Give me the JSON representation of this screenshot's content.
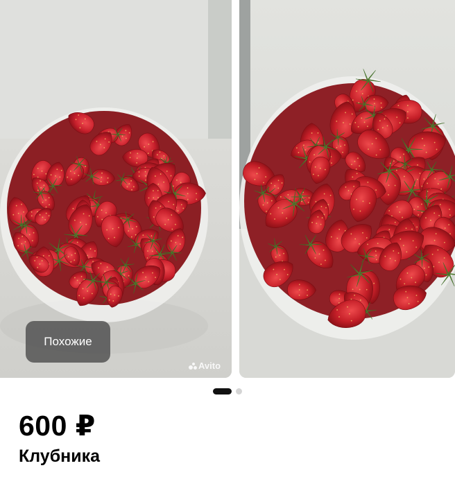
{
  "gallery": {
    "photos": [
      {
        "subject": "bowl of strawberries"
      },
      {
        "subject": "bowl of strawberries"
      }
    ],
    "similar_button_label": "Похожие",
    "watermark": "Avito",
    "active_page": 1,
    "page_count": 2
  },
  "listing": {
    "price": "600 ₽",
    "title": "Клубника"
  },
  "colors": {
    "strawberry": "#c8202c",
    "background": "#ffffff",
    "pager_active": "#111111",
    "pager_inactive": "#d4d4d4"
  }
}
